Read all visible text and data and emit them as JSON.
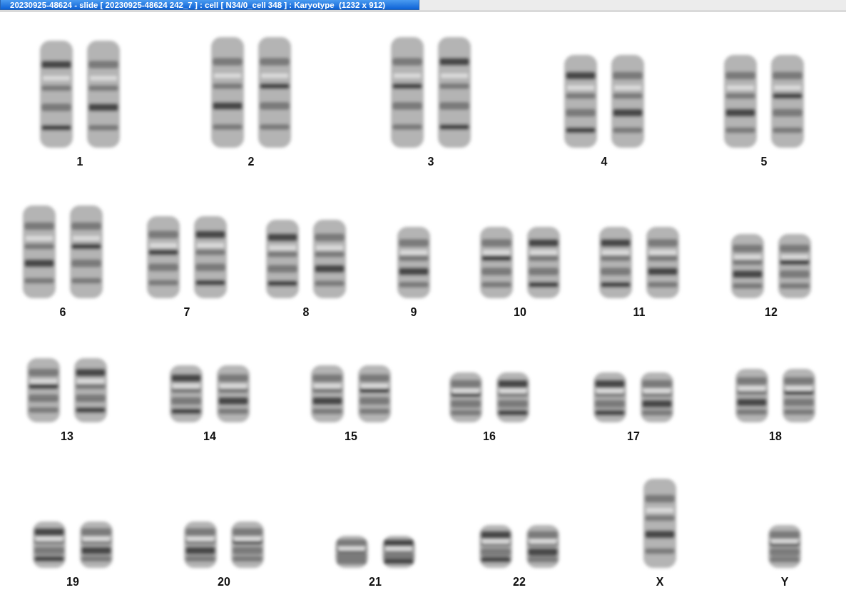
{
  "window": {
    "title": "20230925-48624 - slide [ 20230925-48624 242_7 ] : cell [ N34/0_cell 348 ] : Karyotype  (1232 x 912)"
  },
  "karyotype": {
    "chromosomes": [
      {
        "label": "1",
        "kind": "pair"
      },
      {
        "label": "2",
        "kind": "pair"
      },
      {
        "label": "3",
        "kind": "pair"
      },
      {
        "label": "4",
        "kind": "pair"
      },
      {
        "label": "5",
        "kind": "pair"
      },
      {
        "label": "6",
        "kind": "pair"
      },
      {
        "label": "7",
        "kind": "pair"
      },
      {
        "label": "8",
        "kind": "pair"
      },
      {
        "label": "9",
        "kind": "single"
      },
      {
        "label": "10",
        "kind": "pair"
      },
      {
        "label": "11",
        "kind": "pair"
      },
      {
        "label": "12",
        "kind": "pair"
      },
      {
        "label": "13",
        "kind": "pair"
      },
      {
        "label": "14",
        "kind": "pair"
      },
      {
        "label": "15",
        "kind": "pair"
      },
      {
        "label": "16",
        "kind": "pair"
      },
      {
        "label": "17",
        "kind": "pair"
      },
      {
        "label": "18",
        "kind": "pair"
      },
      {
        "label": "19",
        "kind": "pair"
      },
      {
        "label": "20",
        "kind": "pair"
      },
      {
        "label": "21",
        "kind": "pair"
      },
      {
        "label": "22",
        "kind": "pair"
      },
      {
        "label": "X",
        "kind": "single"
      },
      {
        "label": "Y",
        "kind": "single"
      }
    ]
  }
}
